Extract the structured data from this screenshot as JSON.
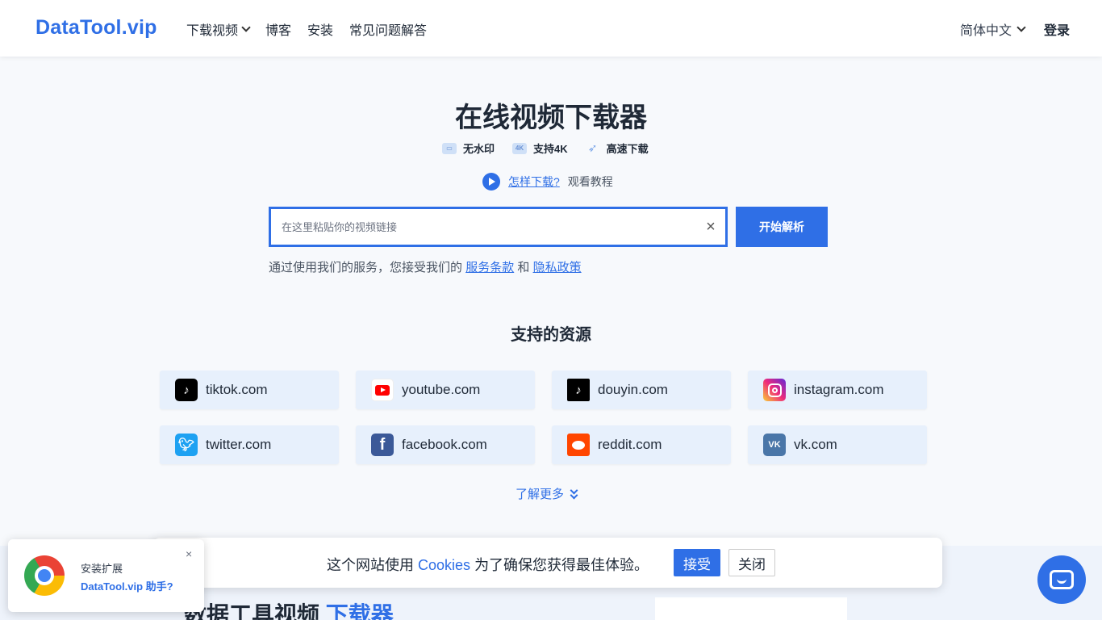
{
  "header": {
    "logo": "DataTool.vip",
    "nav": [
      {
        "label": "下载视频"
      },
      {
        "label": "博客"
      },
      {
        "label": "安装"
      },
      {
        "label": "常见问题解答"
      }
    ],
    "language": "简体中文",
    "login": "登录"
  },
  "hero": {
    "title": "在线视频下载器",
    "features": [
      {
        "icon": "watermark-icon",
        "label": "无水印"
      },
      {
        "icon": "4k-icon",
        "label": "支持4K"
      },
      {
        "icon": "rocket-icon",
        "label": "高速下载"
      }
    ],
    "howto_link": "怎样下载?",
    "howto_sub": "观看教程"
  },
  "search": {
    "placeholder": "在这里粘贴你的视频链接",
    "value": "",
    "clear": "×",
    "button": "开始解析"
  },
  "terms": {
    "prefix": "通过使用我们的服务，您接受我们的",
    "service_link": "服务条款",
    "and": "和",
    "privacy_link": "隐私政策"
  },
  "sources": {
    "title": "支持的资源",
    "items": [
      {
        "name": "tiktok.com",
        "icon": "tiktok-icon",
        "color": "#000000"
      },
      {
        "name": "youtube.com",
        "icon": "youtube-icon",
        "color": "#ff0000"
      },
      {
        "name": "douyin.com",
        "icon": "douyin-icon",
        "color": "#000000"
      },
      {
        "name": "instagram.com",
        "icon": "instagram-icon",
        "color": "#d6249f"
      },
      {
        "name": "twitter.com",
        "icon": "twitter-icon",
        "color": "#1da1f2"
      },
      {
        "name": "facebook.com",
        "icon": "facebook-icon",
        "color": "#3b5998"
      },
      {
        "name": "reddit.com",
        "icon": "reddit-icon",
        "color": "#ff4500"
      },
      {
        "name": "vk.com",
        "icon": "vk-icon",
        "color": "#4a76a8"
      }
    ],
    "more": "了解更多"
  },
  "lower": {
    "heading_a": "数据工具视频",
    "heading_b": "下载器"
  },
  "cookie": {
    "text_a": "这个网站使用",
    "link": "Cookies",
    "text_b": "为了确保您获得最佳体验。",
    "accept": "接受",
    "close": "关闭"
  },
  "extension": {
    "line1": "安装扩展",
    "line2": "DataTool.vip 助手?",
    "close": "×"
  },
  "colors": {
    "accent": "#2f6fe6",
    "card_bg": "#e7f0fc"
  }
}
